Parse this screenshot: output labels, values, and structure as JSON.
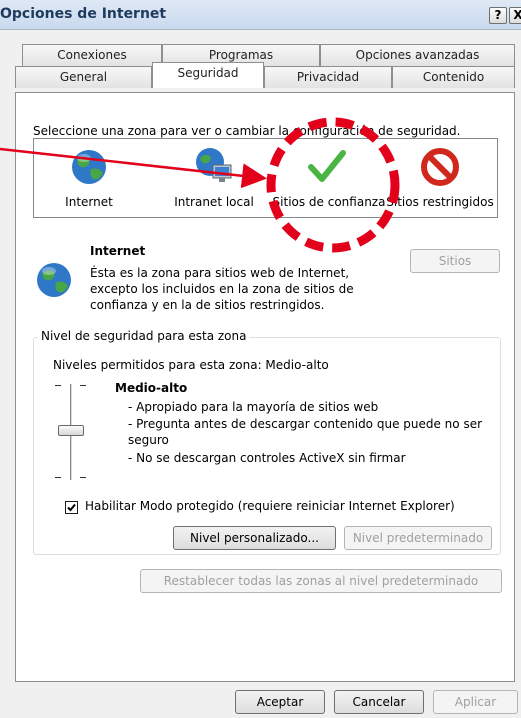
{
  "window": {
    "title": "Opciones de Internet",
    "help_label": "?",
    "close_label": "X"
  },
  "tabs": {
    "row1": [
      {
        "label": "Conexiones"
      },
      {
        "label": "Programas"
      },
      {
        "label": "Opciones avanzadas"
      }
    ],
    "row2": [
      {
        "label": "General"
      },
      {
        "label": "Seguridad"
      },
      {
        "label": "Privacidad"
      },
      {
        "label": "Contenido"
      }
    ],
    "active": "Seguridad"
  },
  "zones": {
    "prompt": "Seleccione una zona para ver o cambiar la configuración de seguridad.",
    "items": [
      {
        "label": "Internet",
        "icon": "globe-icon"
      },
      {
        "label": "Intranet local",
        "icon": "intranet-icon"
      },
      {
        "label": "Sitios de confianza",
        "icon": "checkmark-icon"
      },
      {
        "label": "Sitios restringidos",
        "icon": "restricted-icon"
      }
    ]
  },
  "selected_zone": {
    "name": "Internet",
    "description_lines": [
      "Ésta es la zona para sitios web de Internet,",
      "excepto los incluidos en la zona de sitios de",
      "confianza y en la de sitios restringidos."
    ],
    "sites_button": "Sitios"
  },
  "security_level": {
    "group_label": "Nivel de seguridad para esta zona",
    "allowed_levels": "Niveles permitidos para esta zona: Medio-alto",
    "level_name": "Medio-alto",
    "details": [
      "- Apropiado para la mayoría de sitios web",
      "- Pregunta antes de descargar contenido que puede no ser",
      "seguro",
      "- No se descargan controles ActiveX sin firmar"
    ],
    "protected_mode_label": "Habilitar Modo protegido (requiere reiniciar Internet Explorer)",
    "protected_mode_checked": true,
    "custom_level_button": "Nivel personalizado...",
    "default_level_button": "Nivel predeterminado",
    "reset_all_button": "Restablecer todas las zonas al nivel predeterminado"
  },
  "footer": {
    "ok": "Aceptar",
    "cancel": "Cancelar",
    "apply": "Aplicar"
  },
  "colors": {
    "annotation_red": "#e3001b",
    "check_green": "#4bb543",
    "restricted_red": "#d1281e"
  }
}
